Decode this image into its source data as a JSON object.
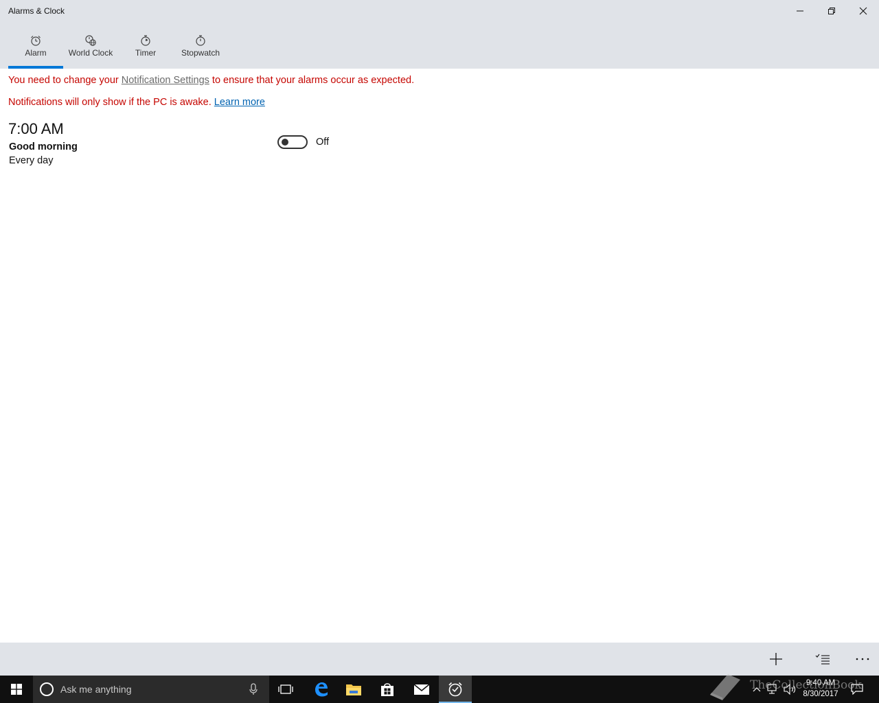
{
  "window": {
    "title": "Alarms & Clock"
  },
  "tabs": [
    {
      "label": "Alarm",
      "icon": "alarm-clock-icon",
      "active": true
    },
    {
      "label": "World Clock",
      "icon": "world-clock-icon",
      "active": false
    },
    {
      "label": "Timer",
      "icon": "timer-icon",
      "active": false
    },
    {
      "label": "Stopwatch",
      "icon": "stopwatch-icon",
      "active": false
    }
  ],
  "notice": {
    "line1_before": "You need to change your ",
    "line1_link": "Notification Settings",
    "line1_after": " to ensure that your alarms occur as expected.",
    "line2_before": "Notifications will only show if the PC is awake. ",
    "line2_link": "Learn more"
  },
  "alarm": {
    "time": "7:00 AM",
    "name": "Good morning",
    "repeat": "Every day",
    "toggle_state": "Off"
  },
  "command_bar": {
    "buttons": [
      "add-icon",
      "select-alarms-icon",
      "more-icon"
    ]
  },
  "taskbar": {
    "search_placeholder": "Ask me anything",
    "clock_time": "9:40 AM",
    "clock_date": "8/30/2017"
  },
  "watermark": {
    "text": "TheCollectionBook"
  },
  "colors": {
    "accent": "#0078d7",
    "warning": "#c50500",
    "chrome": "#e0e3e8",
    "taskbar": "#101010"
  }
}
